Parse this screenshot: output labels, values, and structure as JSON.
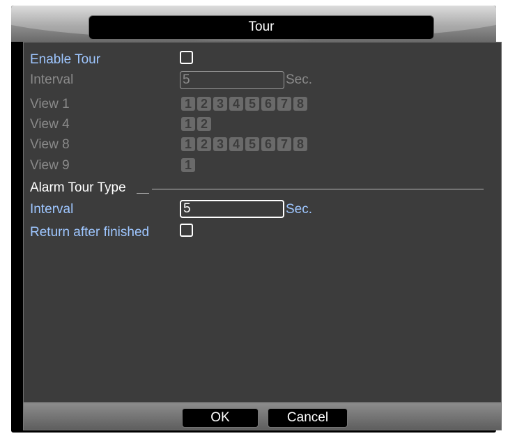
{
  "window": {
    "title": "Tour"
  },
  "tour": {
    "enable_label": "Enable Tour",
    "enable_checked": false,
    "interval_label": "Interval",
    "interval_value": "5",
    "interval_unit": "Sec.",
    "views": [
      {
        "label": "View 1",
        "chips": [
          "1",
          "2",
          "3",
          "4",
          "5",
          "6",
          "7",
          "8"
        ]
      },
      {
        "label": "View 4",
        "chips": [
          "1",
          "2"
        ]
      },
      {
        "label": "View 8",
        "chips": [
          "1",
          "2",
          "3",
          "4",
          "5",
          "6",
          "7",
          "8"
        ]
      },
      {
        "label": "View 9",
        "chips": [
          "1"
        ]
      }
    ]
  },
  "alarm": {
    "section_label": "Alarm Tour Type",
    "interval_label": "Interval",
    "interval_value": "5",
    "interval_unit": "Sec.",
    "return_label": "Return after finished",
    "return_checked": false
  },
  "footer": {
    "ok_label": "OK",
    "cancel_label": "Cancel"
  }
}
